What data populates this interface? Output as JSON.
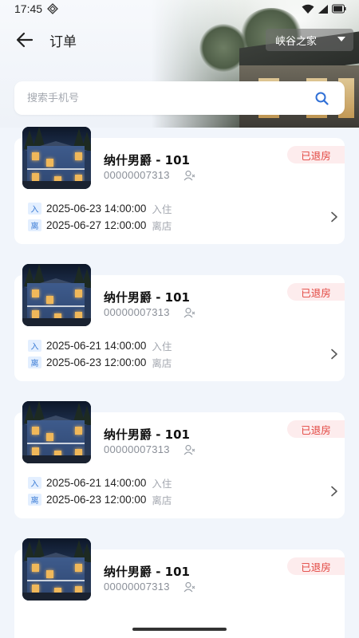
{
  "status_bar": {
    "time": "17:45",
    "icons": [
      "nfc-icon",
      "wifi-icon",
      "signal-icon",
      "battery-icon"
    ]
  },
  "nav": {
    "title": "订单",
    "back_icon": "arrow-left-icon"
  },
  "store_selector": {
    "value": "峡谷之家"
  },
  "search": {
    "placeholder": "搜索手机号",
    "value": "",
    "icon": "search-icon"
  },
  "colors": {
    "accent": "#3a7bd5",
    "badge_bg": "#fdeced",
    "badge_text": "#e2453f",
    "page_bg": "#f1f5fb"
  },
  "orders": [
    {
      "name": "纳什男爵 - 101",
      "order_id": "00000007313",
      "status": "已退房",
      "check_in_tag": "入",
      "check_in": "2025-06-23 14:00:00",
      "check_in_label": "入住",
      "check_out_tag": "离",
      "check_out": "2025-06-27 12:00:00",
      "check_out_label": "离店"
    },
    {
      "name": "纳什男爵 - 101",
      "order_id": "00000007313",
      "status": "已退房",
      "check_in_tag": "入",
      "check_in": "2025-06-21 14:00:00",
      "check_in_label": "入住",
      "check_out_tag": "离",
      "check_out": "2025-06-23 12:00:00",
      "check_out_label": "离店"
    },
    {
      "name": "纳什男爵 - 101",
      "order_id": "00000007313",
      "status": "已退房",
      "check_in_tag": "入",
      "check_in": "2025-06-21 14:00:00",
      "check_in_label": "入住",
      "check_out_tag": "离",
      "check_out": "2025-06-23 12:00:00",
      "check_out_label": "离店"
    },
    {
      "name": "纳什男爵 - 101",
      "order_id": "00000007313",
      "status": "已退房"
    }
  ]
}
